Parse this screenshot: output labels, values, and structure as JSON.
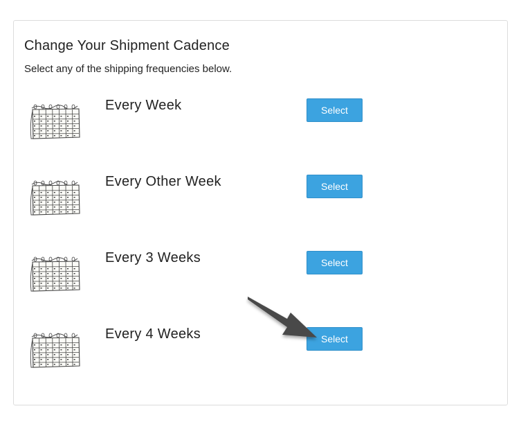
{
  "panel": {
    "title": "Change Your Shipment Cadence",
    "subtitle": "Select any of the shipping frequencies below."
  },
  "options": [
    {
      "label": "Every Week",
      "button_label": "Select",
      "icon": "calendar-icon"
    },
    {
      "label": "Every Other Week",
      "button_label": "Select",
      "icon": "calendar-icon"
    },
    {
      "label": "Every 3 Weeks",
      "button_label": "Select",
      "icon": "calendar-icon"
    },
    {
      "label": "Every 4 Weeks",
      "button_label": "Select",
      "icon": "calendar-icon"
    }
  ],
  "annotation": {
    "icon": "pointer-arrow-icon",
    "color": "#4a4a4a"
  },
  "colors": {
    "button_bg": "#3ca3e0",
    "button_text": "#ffffff",
    "panel_border": "#dcdcdc"
  }
}
